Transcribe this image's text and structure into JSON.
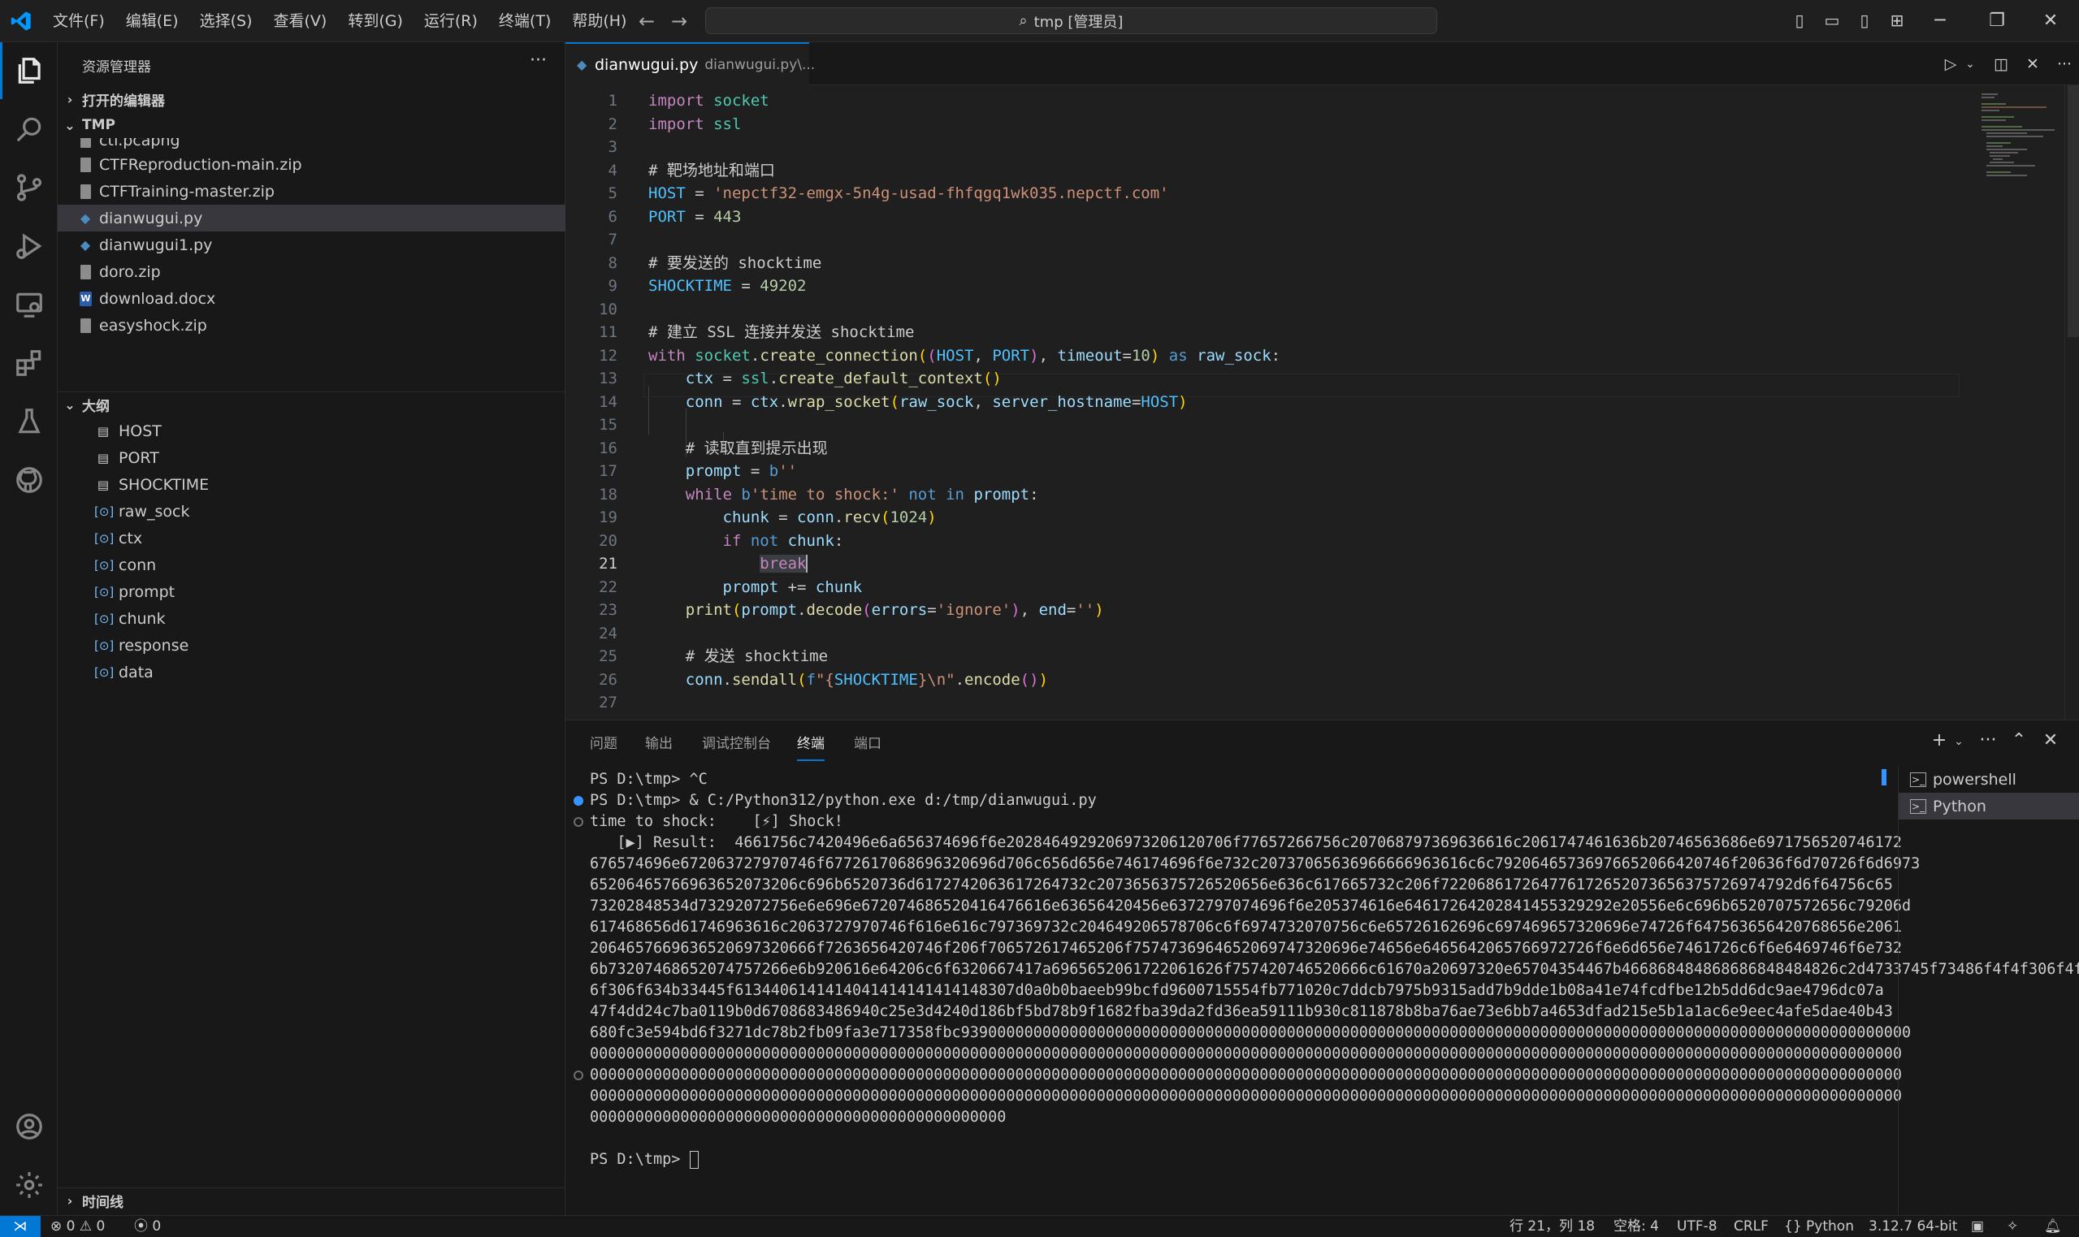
{
  "titlebar": {
    "menus": [
      "文件(F)",
      "编辑(E)",
      "选择(S)",
      "查看(V)",
      "转到(G)",
      "运行(R)",
      "终端(T)",
      "帮助(H)"
    ],
    "search_text": "tmp [管理员]"
  },
  "sidebar": {
    "title": "资源管理器",
    "open_editors": "打开的编辑器",
    "folder": "TMP",
    "files": [
      {
        "name": "ctf.pcapng",
        "type": "zip"
      },
      {
        "name": "CTFReproduction-main.zip",
        "type": "zip"
      },
      {
        "name": "CTFTraining-master.zip",
        "type": "zip"
      },
      {
        "name": "dianwugui.py",
        "type": "py",
        "selected": true
      },
      {
        "name": "dianwugui1.py",
        "type": "py"
      },
      {
        "name": "doro.zip",
        "type": "zip"
      },
      {
        "name": "download.docx",
        "type": "docx"
      },
      {
        "name": "easyshock.zip",
        "type": "zip"
      }
    ],
    "outline_title": "大纲",
    "outline": [
      {
        "name": "HOST",
        "kind": "const"
      },
      {
        "name": "PORT",
        "kind": "const"
      },
      {
        "name": "SHOCKTIME",
        "kind": "const"
      },
      {
        "name": "raw_sock",
        "kind": "var"
      },
      {
        "name": "ctx",
        "kind": "var"
      },
      {
        "name": "conn",
        "kind": "var"
      },
      {
        "name": "prompt",
        "kind": "var"
      },
      {
        "name": "chunk",
        "kind": "var"
      },
      {
        "name": "response",
        "kind": "var"
      },
      {
        "name": "data",
        "kind": "var"
      }
    ],
    "timeline": "时间线"
  },
  "editor": {
    "tab_name": "dianwugui.py",
    "tab_desc": "dianwugui.py\\...",
    "current_line": 21
  },
  "panel": {
    "tabs": [
      "问题",
      "输出",
      "调试控制台",
      "终端",
      "端口"
    ],
    "active_tab": "终端",
    "terminal_lines": [
      "PS D:\\tmp> ^C",
      "PS D:\\tmp> & C:/Python312/python.exe d:/tmp/dianwugui.py",
      "time to shock:    [⚡] Shock!",
      "   [▶] Result:  4661756c7420496e6a656374696f6e20284649292069732061207​06f77657266756c207068797369636616c2061747461636b20746563686e6971756520746172",
      "676574696e672063727970746f6772617068696320696d706c656d656e746174696f6e732c20737065636966666963616c6c79206465736976652066420746f20636f6d70726f6d6973",
      "65206465766963652073206c696b6520736d6172742063617264732c2073656375726520656e636c617665732c206f722068617264776172652073656375726974792d6f64756c65",
      "73202848534d73292072756e6e696e672074686520416476616e63656420456e6372797074696f6e205374616e64617264202841455329292e20556e6c696b6520707572656c79206d",
      "617468656d61746963616c2063727970746f616e616c797369732c204649206578706c6f6974732070756c6e65726162696c697469657320696e74726f647563656420768656e2061",
      "2064657669636520697320666f7263656420746f206f706572617465206f7574736964652069747320696e74656e6465642065766972726f6e6d656e7461726c6f6e6469746f6e732",
      "6b73207468652074757266e6b920616e64206c6f6320667417a6965652061722061626f757420746520666c61670a20697320e65704354467b466868484868686848484826c2d4733745f73486f4f4f306f4f6f6f3030",
      "6f306f634b33445f6134406141414041414141414148307d0a0b0baeeb99bcfd9600715554fb771020c7ddcb7975b9315add7b9dde1b08a41e74fcdfbe12b5dd6dc9ae4796dc07a",
      "47f4dd24c7ba0119b0d6708683486940c25e3d4240d186bf5bd78b9f1682fba39da2fd36ea59111b930c811878b8ba76ae73e6bb7a4653dfad215e5b1a1ac6e9eec4afe5dae40b43",
      "680fc3e594bd6f3271dc78b2fb09fa3e717358fbc939000000000000000000000000000000000000000000000000000000000000000000000000000000000000000000000000000000",
      "0000000000000000000000000000000000000000000000000000000000000000000000000000000000000000000000000000000000000000000000000000000000000000000000000",
      "0000000000000000000000000000000000000000000000000000000000000000000000000000000000000000000000000000000000000000000000000000000000000000000000000",
      "0000000000000000000000000000000000000000000000000000000000000000000000000000000000000000000000000000000000000000000000000000000000000000000000000",
      "0000000000000000000000000000000000000000000000",
      "",
      "PS D:\\tmp> "
    ],
    "terminals": [
      "powershell",
      "Python"
    ],
    "active_terminal": "Python"
  },
  "statusbar": {
    "errors": "0",
    "warnings": "0",
    "ports": "0",
    "position": "行 21，列 18",
    "spaces": "空格: 4",
    "encoding": "UTF-8",
    "eol": "CRLF",
    "language": "Python",
    "interpreter": "3.12.7 64-bit"
  },
  "colors": {
    "accent": "#0078d4",
    "background": "#1f1f1f",
    "sidebar": "#181818"
  }
}
